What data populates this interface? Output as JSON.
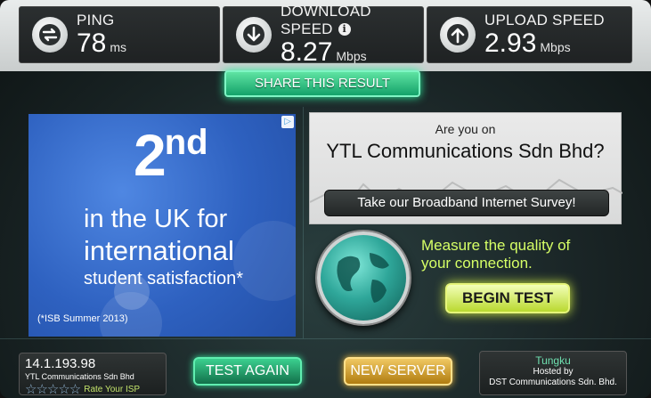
{
  "stats": {
    "ping": {
      "label": "PING",
      "value": "78",
      "unit": "ms",
      "icon": "swap-arrows-icon"
    },
    "download": {
      "label": "DOWNLOAD SPEED",
      "value": "8.27",
      "unit": "Mbps",
      "info": "i",
      "icon": "arrow-down-icon"
    },
    "upload": {
      "label": "UPLOAD SPEED",
      "value": "2.93",
      "unit": "Mbps",
      "icon": "arrow-up-icon"
    }
  },
  "share_label": "SHARE THIS RESULT",
  "ad": {
    "rank": "2",
    "suffix": "nd",
    "line2": "in the UK for",
    "line3": "international",
    "line4": "student satisfaction*",
    "footnote": "(*ISB Summer 2013)",
    "adchoices": "▷"
  },
  "survey": {
    "question": "Are you on",
    "isp": "YTL Communications Sdn Bhd?",
    "button": "Take our Broadband Internet Survey!"
  },
  "measure": {
    "line1": "Measure the quality of",
    "line2": "your connection.",
    "button": "BEGIN TEST"
  },
  "bottom": {
    "ip": "14.1.193.98",
    "isp_name": "YTL Communications Sdn Bhd",
    "stars": "☆☆☆☆☆",
    "rate": "Rate Your ISP",
    "test_again": "TEST AGAIN",
    "new_server": "NEW SERVER",
    "city": "Tungku",
    "hosted_by": "Hosted by",
    "host": "DST Communications Sdn. Bhd."
  }
}
